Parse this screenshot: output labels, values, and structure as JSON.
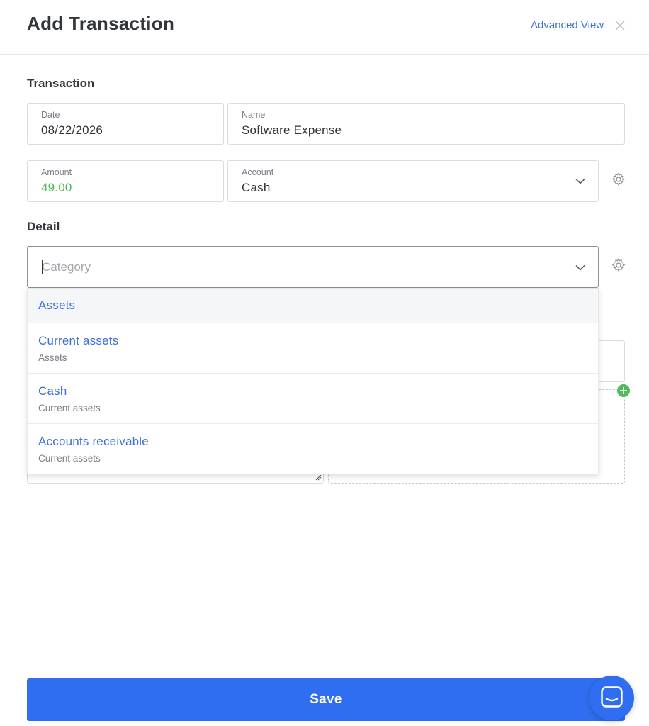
{
  "header": {
    "title": "Add Transaction",
    "advanced_view_label": "Advanced View",
    "close_icon": "close-icon"
  },
  "transaction": {
    "section_title": "Transaction",
    "date": {
      "label": "Date",
      "value": "08/22/2026"
    },
    "name": {
      "label": "Name",
      "value": "Software Expense"
    },
    "amount": {
      "label": "Amount",
      "value": "49.00",
      "color": "#4dbd5a"
    },
    "account": {
      "label": "Account",
      "value": "Cash",
      "icon": "chevron-down-icon",
      "settings_icon": "gear-icon"
    }
  },
  "detail": {
    "section_title": "Detail",
    "category": {
      "placeholder": "Category",
      "icon": "chevron-down-icon",
      "settings_icon": "gear-icon"
    },
    "dropdown_options": [
      {
        "label": "Assets",
        "parent": ""
      },
      {
        "label": "Current assets",
        "parent": "Assets"
      },
      {
        "label": "Cash",
        "parent": "Current assets"
      },
      {
        "label": "Accounts receivable",
        "parent": "Current assets"
      }
    ]
  },
  "footer": {
    "save_label": "Save",
    "chat_icon": "chat-icon"
  },
  "colors": {
    "accent": "#2f6ef0",
    "link": "#3d70e0",
    "positive": "#4dbd5a"
  }
}
